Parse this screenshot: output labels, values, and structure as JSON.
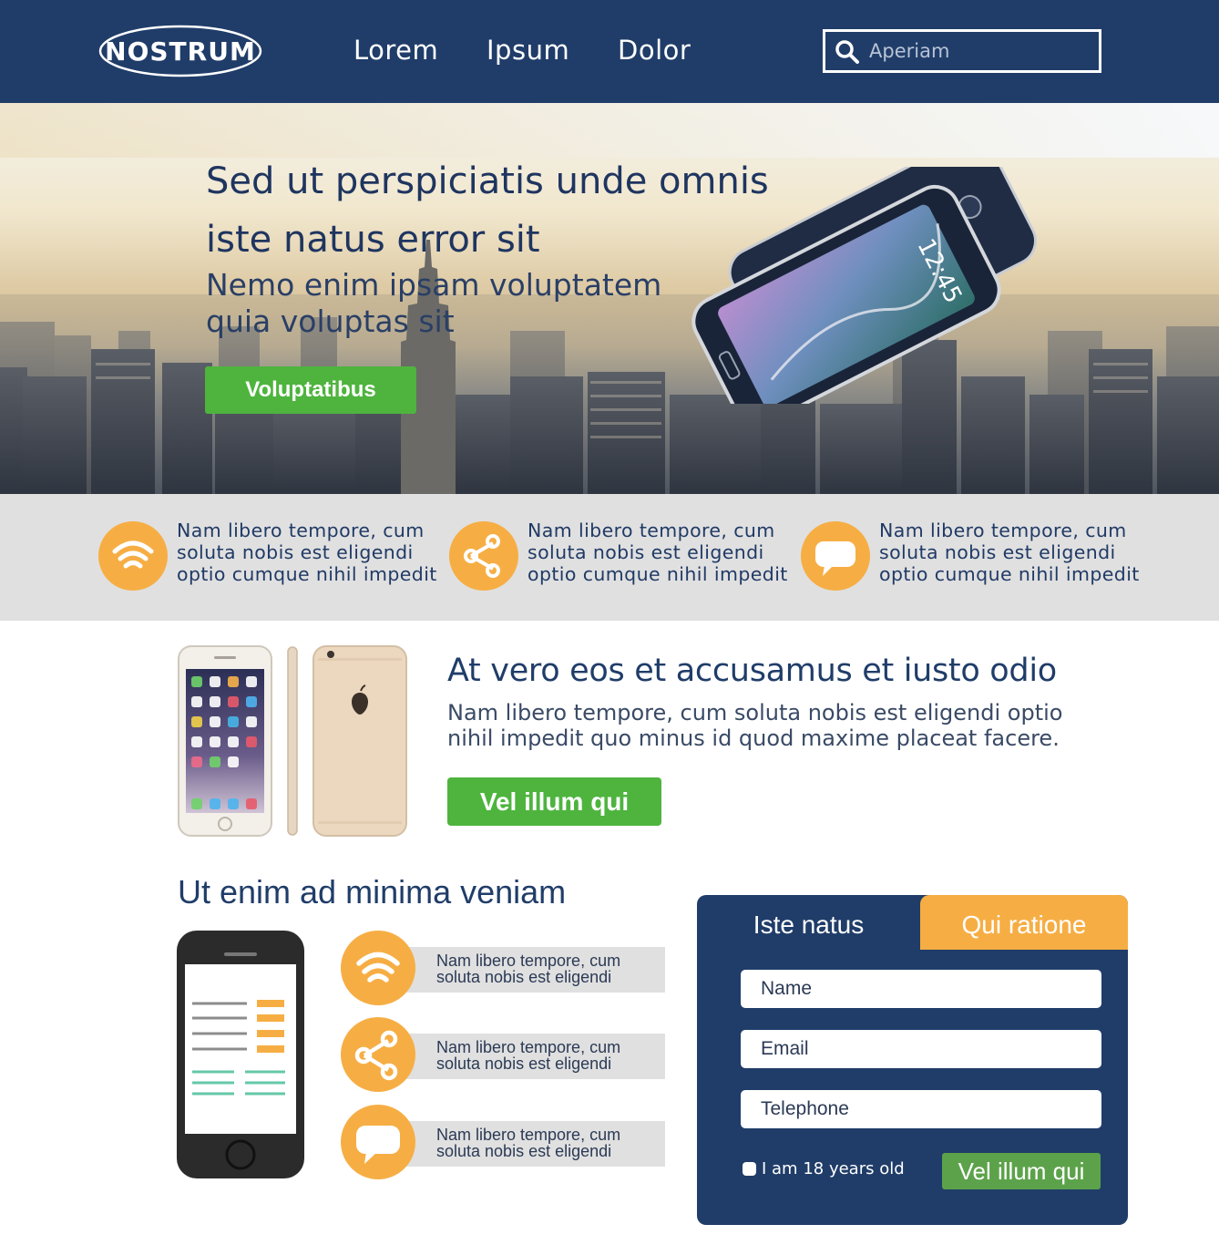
{
  "header": {
    "logo_text": "NOSTRUM",
    "nav": [
      "Lorem",
      "Ipsum",
      "Dolor"
    ],
    "search_placeholder": "Aperiam"
  },
  "hero": {
    "title_line1": "Sed ut perspiciatis unde omnis",
    "title_line2": "iste natus error sit",
    "subtitle": "Nemo enim ipsam voluptatem quia voluptas sit",
    "button": "Voluptatibus"
  },
  "features": [
    {
      "icon": "wifi-icon",
      "text": "Nam libero tempore, cum soluta nobis est eligendi optio cumque nihil impedit"
    },
    {
      "icon": "share-icon",
      "text": "Nam libero tempore, cum soluta nobis est eligendi optio cumque nihil impedit"
    },
    {
      "icon": "chat-icon",
      "text": "Nam libero tempore, cum soluta nobis est eligendi optio cumque nihil impedit"
    }
  ],
  "product": {
    "title": "At vero eos et accusamus et iusto odio",
    "description": "Nam libero tempore, cum soluta nobis est eligendi optio nihil impedit quo minus id quod maxime placeat facere.",
    "button": "Vel illum qui"
  },
  "lower": {
    "title": "Ut enim ad minima veniam",
    "rows": [
      {
        "icon": "wifi-icon",
        "text": "Nam libero tempore, cum soluta nobis est eligendi"
      },
      {
        "icon": "share-icon",
        "text": "Nam libero tempore, cum soluta nobis est eligendi"
      },
      {
        "icon": "chat-icon",
        "text": "Nam libero tempore, cum soluta nobis est eligendi"
      }
    ]
  },
  "form": {
    "tab_active": "Iste natus",
    "tab_inactive": "Qui ratione",
    "name_placeholder": "Name",
    "email_placeholder": "Email",
    "phone_placeholder": "Telephone",
    "age_label": "I am 18 years old",
    "submit": "Vel illum qui"
  },
  "colors": {
    "navy": "#203d69",
    "orange": "#f6ae44",
    "green": "#4eb43e",
    "strip_gray": "#e0e0e0"
  }
}
